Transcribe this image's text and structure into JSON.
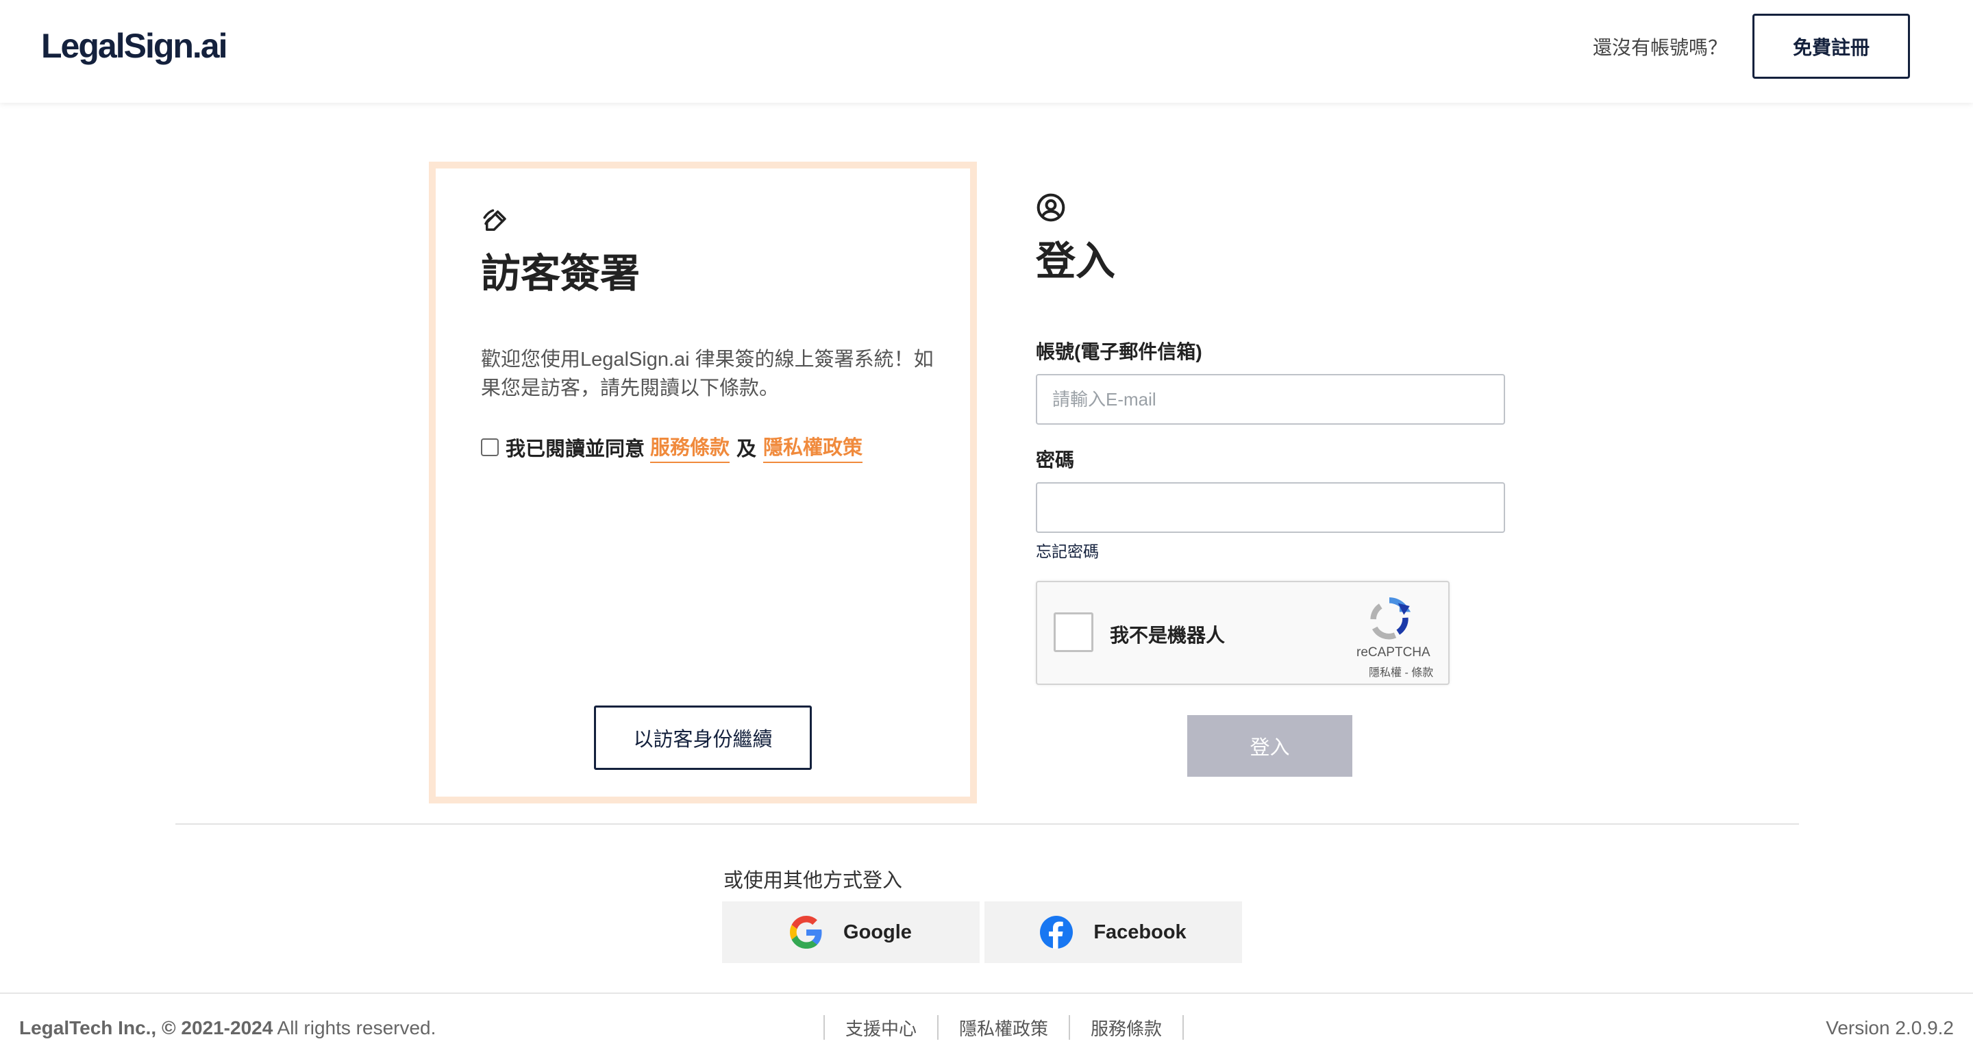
{
  "header": {
    "logo": "LegalSign.ai",
    "no_account_text": "還沒有帳號嗎？",
    "register_label": "免費註冊"
  },
  "guest": {
    "title": "訪客簽署",
    "description": "歡迎您使用LegalSign.ai 律果簽的線上簽署系統！如果您是訪客，請先閱讀以下條款。",
    "agree_prefix": "我已閱讀並同意",
    "terms_link": "服務條款",
    "and": "及",
    "privacy_link": "隱私權政策",
    "continue_label": "以訪客身份繼續"
  },
  "login": {
    "title": "登入",
    "email_label": "帳號(電子郵件信箱)",
    "email_placeholder": "請輸入E-mail",
    "email_value": "",
    "password_label": "密碼",
    "password_value": "",
    "forgot_label": "忘記密碼",
    "recaptcha": {
      "label": "我不是機器人",
      "brand": "reCAPTCHA",
      "terms": "隱私權 - 條款"
    },
    "submit_label": "登入"
  },
  "social": {
    "title": "或使用其他方式登入",
    "google_label": "Google",
    "facebook_label": "Facebook"
  },
  "footer": {
    "company": "LegalTech Inc.,",
    "copyright_years": "© 2021-2024",
    "rights": "All rights reserved.",
    "links": [
      "支援中心",
      "隱私權政策",
      "服務條款"
    ],
    "version": "Version 2.0.9.2"
  },
  "colors": {
    "brand_navy": "#14213d",
    "accent_orange": "#f08a3c",
    "guest_border": "#fde6d3",
    "disabled_button": "#b7b8c4"
  }
}
